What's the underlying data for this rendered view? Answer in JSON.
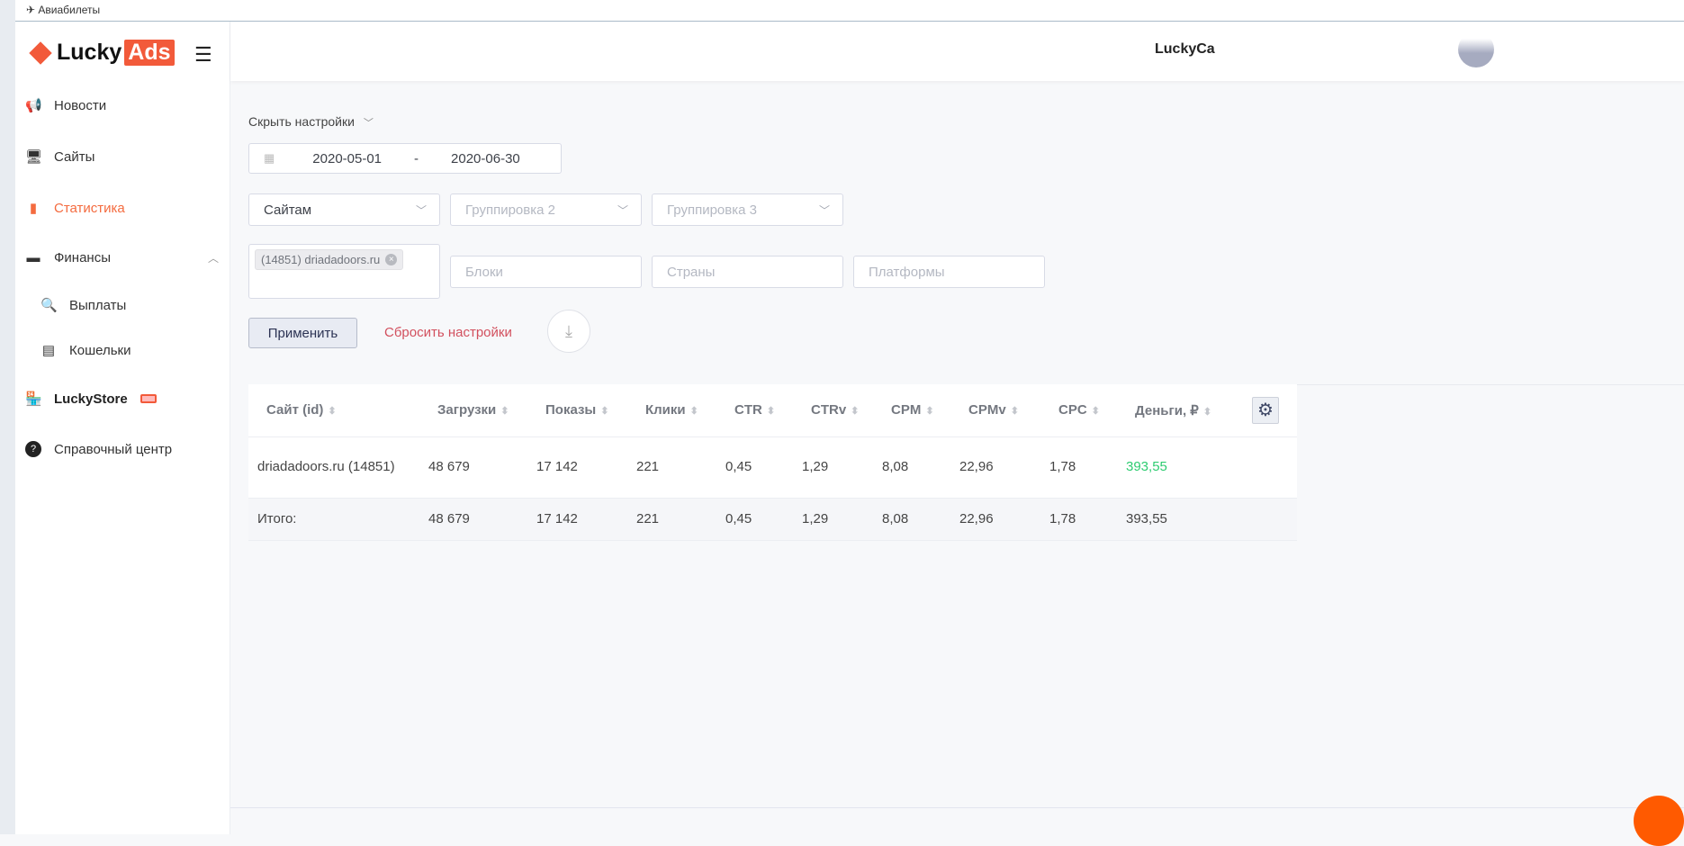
{
  "bookmark": {
    "label": "Авиабилеты"
  },
  "logo": {
    "lucky": "Lucky",
    "ads": "Ads"
  },
  "sidebar": {
    "items": [
      {
        "label": "Новости",
        "icon": "megaphone-icon"
      },
      {
        "label": "Сайты",
        "icon": "monitor-icon"
      },
      {
        "label": "Статистика",
        "icon": "bar-chart-icon"
      },
      {
        "label": "Финансы",
        "icon": "wallet-icon"
      },
      {
        "label": "Выплаты",
        "icon": "search-dollar-icon"
      },
      {
        "label": "Кошельки",
        "icon": "card-icon"
      },
      {
        "label": "LuckyStore",
        "icon": "store-icon"
      },
      {
        "label": "Справочный центр",
        "icon": "help-icon"
      }
    ]
  },
  "header": {
    "user": "LuckyCa"
  },
  "filters": {
    "toggle": "Скрыть настройки",
    "date_from": "2020-05-01",
    "date_sep": "-",
    "date_to": "2020-06-30",
    "group1": "Сайтам",
    "group2": "Группировка 2",
    "group3": "Группировка 3",
    "site_tag": "(14851) driadadoors.ru",
    "blocks": "Блоки",
    "countries": "Страны",
    "platforms": "Платформы",
    "apply": "Применить",
    "reset": "Сбросить настройки"
  },
  "table": {
    "columns": [
      "Сайт (id)",
      "Загрузки",
      "Показы",
      "Клики",
      "CTR",
      "CTRv",
      "CPM",
      "CPMv",
      "CPC",
      "Деньги, ₽"
    ],
    "rows": [
      [
        "driadadoors.ru (14851)",
        "48 679",
        "17 142",
        "221",
        "0,45",
        "1,29",
        "8,08",
        "22,96",
        "1,78",
        "393,55"
      ]
    ],
    "total": [
      "Итого:",
      "48 679",
      "17 142",
      "221",
      "0,45",
      "1,29",
      "8,08",
      "22,96",
      "1,78",
      "393,55"
    ]
  },
  "colors": {
    "accent": "#f46b3f",
    "money": "#2ecc71",
    "reset": "#d2505e"
  }
}
